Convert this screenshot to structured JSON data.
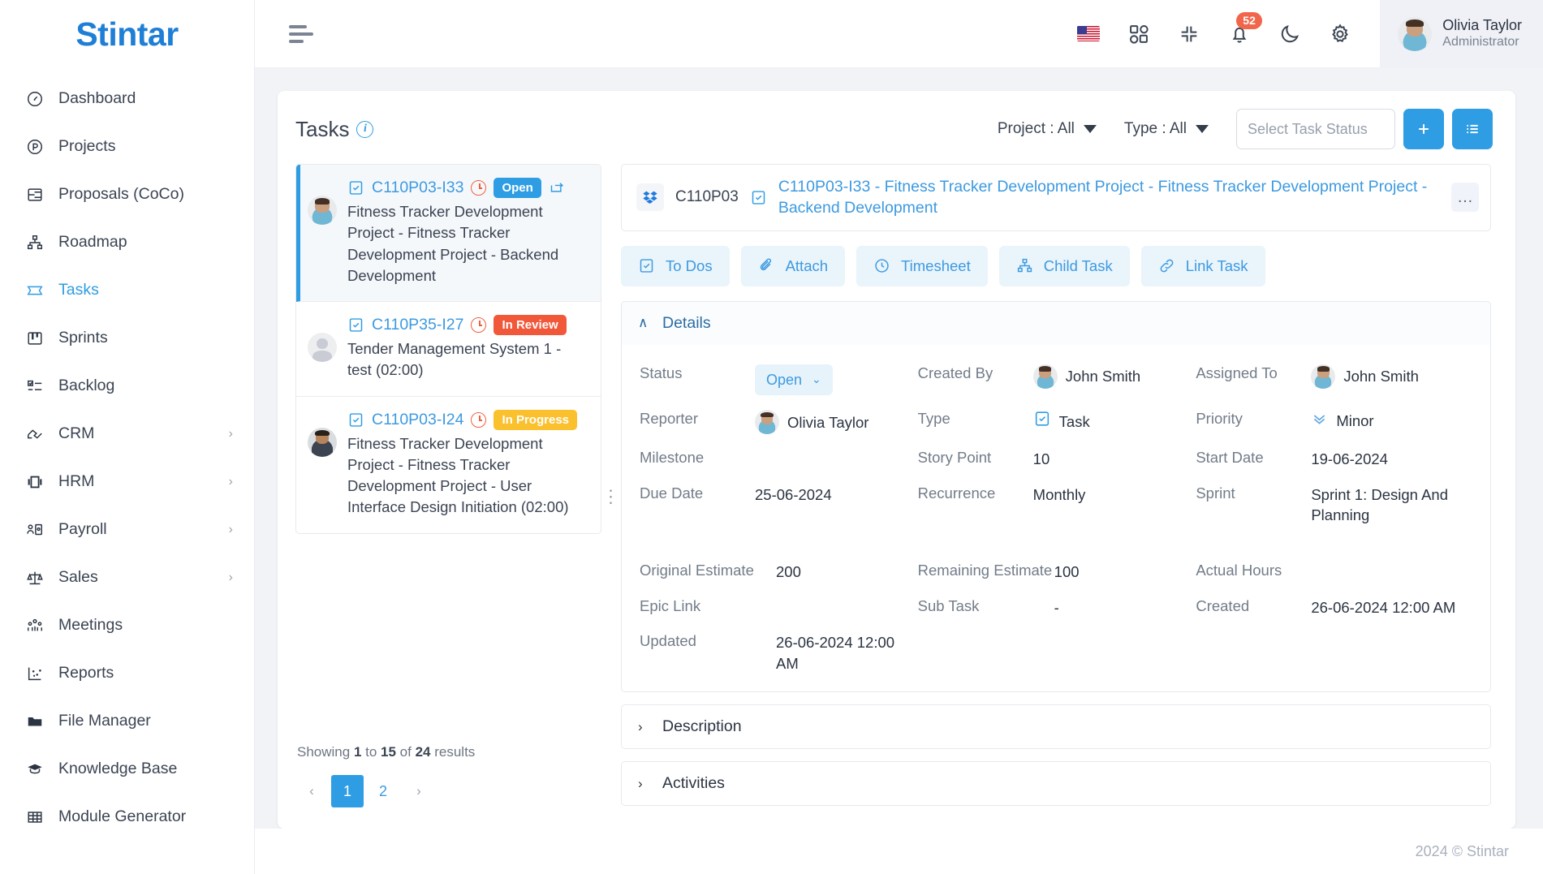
{
  "brand": {
    "logo": "Stintar",
    "accent": "#2f9de3"
  },
  "sidebar": {
    "items": [
      {
        "label": "Dashboard",
        "icon": "gauge-icon",
        "has_submenu": false
      },
      {
        "label": "Projects",
        "icon": "circle-p-icon",
        "has_submenu": false
      },
      {
        "label": "Proposals (CoCo)",
        "icon": "layout-icon",
        "has_submenu": false
      },
      {
        "label": "Roadmap",
        "icon": "sitemap-icon",
        "has_submenu": false
      },
      {
        "label": "Tasks",
        "icon": "ticket-icon",
        "has_submenu": false,
        "active": true
      },
      {
        "label": "Sprints",
        "icon": "board-icon",
        "has_submenu": false
      },
      {
        "label": "Backlog",
        "icon": "checklist-icon",
        "has_submenu": false
      },
      {
        "label": "CRM",
        "icon": "handshake-icon",
        "has_submenu": true
      },
      {
        "label": "HRM",
        "icon": "id-card-icon",
        "has_submenu": true
      },
      {
        "label": "Payroll",
        "icon": "user-card-icon",
        "has_submenu": true
      },
      {
        "label": "Sales",
        "icon": "scales-icon",
        "has_submenu": true
      },
      {
        "label": "Meetings",
        "icon": "people-icon",
        "has_submenu": false
      },
      {
        "label": "Reports",
        "icon": "scatter-chart-icon",
        "has_submenu": false
      },
      {
        "label": "File Manager",
        "icon": "folder-icon",
        "has_submenu": false
      },
      {
        "label": "Knowledge Base",
        "icon": "graduation-cap-icon",
        "has_submenu": false
      },
      {
        "label": "Module Generator",
        "icon": "table-grid-icon",
        "has_submenu": false
      }
    ],
    "submenu_chevron": "›"
  },
  "topbar": {
    "menu_icon": "hamburger-icon",
    "icons": [
      {
        "name": "language-flag-icon",
        "label": "US"
      },
      {
        "name": "apps-grid-icon"
      },
      {
        "name": "fullscreen-collapse-icon"
      },
      {
        "name": "bell-icon",
        "badge": "52"
      },
      {
        "name": "dark-mode-moon-icon"
      },
      {
        "name": "settings-gear-icon"
      }
    ],
    "profile": {
      "name": "Olivia Taylor",
      "role": "Administrator"
    }
  },
  "page": {
    "title": "Tasks",
    "info_icon": "info-icon",
    "filters": [
      {
        "label": "Project : All",
        "name": "project-filter"
      },
      {
        "label": "Type : All",
        "name": "type-filter"
      }
    ],
    "status_search": {
      "placeholder": "Select Task Status",
      "value": ""
    },
    "add_button_icon": "plus-icon",
    "list_button_icon": "list-icon"
  },
  "task_list": {
    "items": [
      {
        "code": "C110P03-I33",
        "status": "Open",
        "status_class": "open",
        "description": "Fitness Tracker Development Project - Fitness Tracker Development Project - Backend Development",
        "avatar": "man1",
        "selected": true,
        "has_recur_icon": true
      },
      {
        "code": "C110P35-I27",
        "status": "In Review",
        "status_class": "review",
        "description": "Tender Management System 1 - test (02:00)",
        "avatar": "blank",
        "selected": false,
        "has_recur_icon": false
      },
      {
        "code": "C110P03-I24",
        "status": "In Progress",
        "status_class": "progress",
        "description": "Fitness Tracker Development Project - Fitness Tracker Development Project - User Interface Design Initiation (02:00)",
        "avatar": "man2",
        "selected": false,
        "has_recur_icon": false
      }
    ],
    "showing_prefix": "Showing ",
    "showing_from": "1",
    "showing_mid": " to ",
    "showing_to": "15",
    "showing_mid2": " of ",
    "showing_total": "24",
    "showing_suffix": " results",
    "pagination": {
      "prev": "‹",
      "pages": [
        "1",
        "2"
      ],
      "current": "1",
      "next": "›"
    }
  },
  "detail": {
    "project_code": "C110P03",
    "project_icon": "dropbox-icon",
    "task_icon": "task-check-icon",
    "title": "C110P03-I33 - Fitness Tracker Development Project - Fitness Tracker Development Project - Backend Development",
    "more_menu": "…",
    "tabs": [
      {
        "label": "To Dos",
        "icon": "checkbox-icon"
      },
      {
        "label": "Attach",
        "icon": "paperclip-icon"
      },
      {
        "label": "Timesheet",
        "icon": "clock-icon"
      },
      {
        "label": "Child Task",
        "icon": "sitemap-icon"
      },
      {
        "label": "Link Task",
        "icon": "link-icon"
      }
    ],
    "sections": {
      "details": {
        "title": "Details",
        "expanded": true,
        "chevron": "∧"
      },
      "description": {
        "title": "Description",
        "expanded": false,
        "chevron": "›"
      },
      "activities": {
        "title": "Activities",
        "expanded": false,
        "chevron": "›"
      }
    },
    "fields": {
      "status": {
        "label": "Status",
        "value": "Open"
      },
      "created_by": {
        "label": "Created By",
        "value": "John Smith"
      },
      "assigned_to": {
        "label": "Assigned To",
        "value": "John Smith"
      },
      "reporter": {
        "label": "Reporter",
        "value": "Olivia Taylor"
      },
      "type": {
        "label": "Type",
        "value": "Task"
      },
      "priority": {
        "label": "Priority",
        "value": "Minor"
      },
      "milestone": {
        "label": "Milestone",
        "value": ""
      },
      "story_point": {
        "label": "Story Point",
        "value": "10"
      },
      "start_date": {
        "label": "Start Date",
        "value": "19-06-2024"
      },
      "due_date": {
        "label": "Due Date",
        "value": "25-06-2024"
      },
      "recurrence": {
        "label": "Recurrence",
        "value": "Monthly"
      },
      "sprint": {
        "label": "Sprint",
        "value": "Sprint 1: Design And Planning"
      },
      "original_estimate": {
        "label": "Original Estimate",
        "value": "200"
      },
      "remaining_estimate": {
        "label": "Remaining Estimate",
        "value": "100"
      },
      "actual_hours": {
        "label": "Actual Hours",
        "value": ""
      },
      "epic_link": {
        "label": "Epic Link",
        "value": ""
      },
      "sub_task": {
        "label": "Sub Task",
        "value": "-"
      },
      "created": {
        "label": "Created",
        "value": "26-06-2024 12:00 AM"
      },
      "updated": {
        "label": "Updated",
        "value": "26-06-2024 12:00 AM"
      }
    }
  },
  "footer": {
    "copyright": "2024 © Stintar"
  }
}
